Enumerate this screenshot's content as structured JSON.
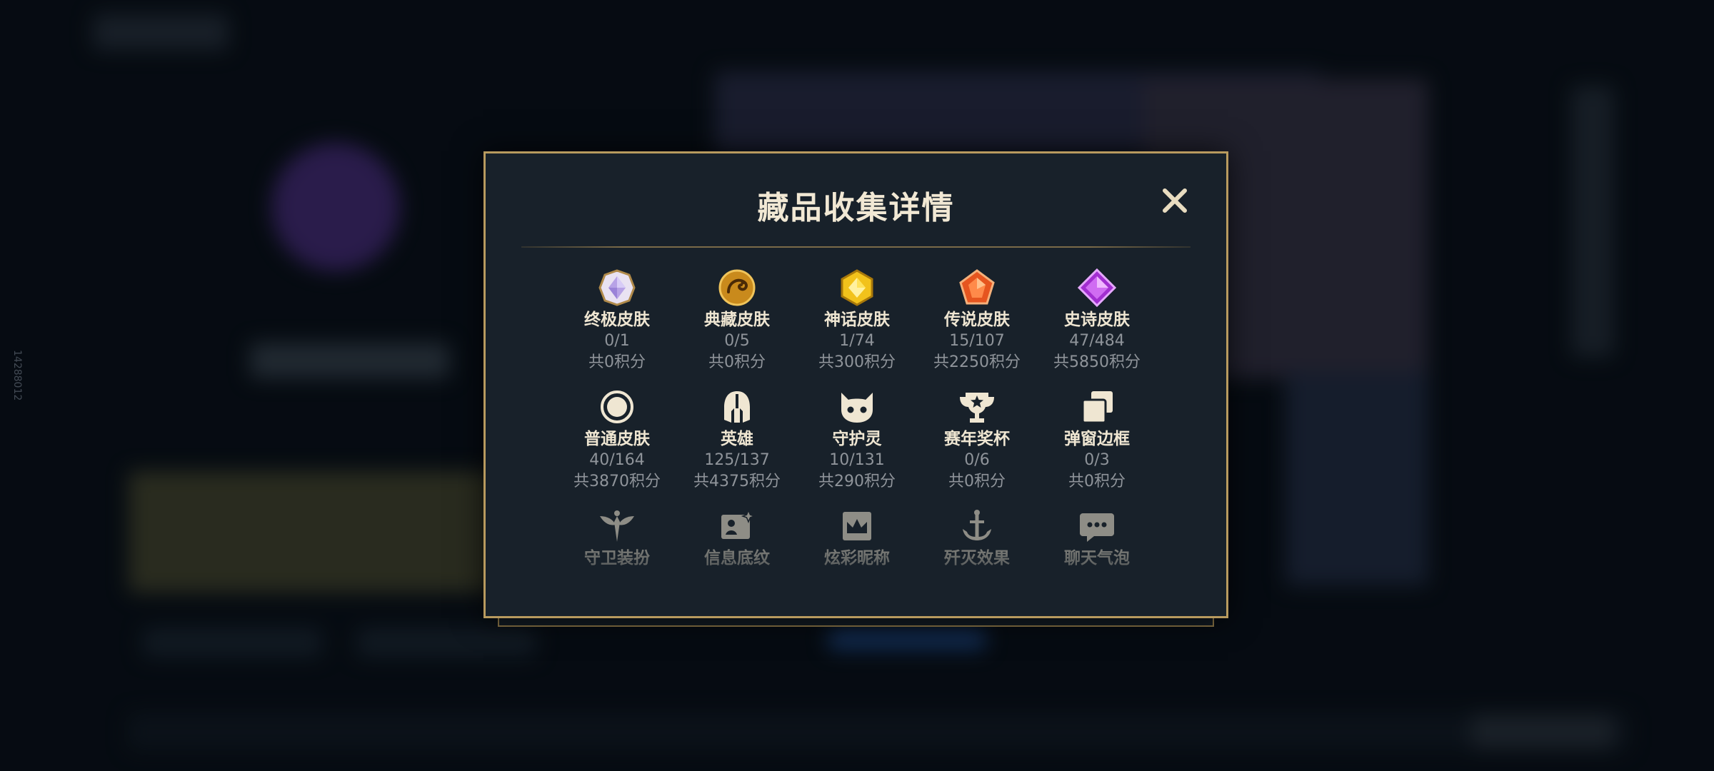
{
  "side_id": "14288012",
  "modal": {
    "title": "藏品收集详情",
    "close_icon": "close-icon"
  },
  "rows": [
    [
      {
        "label": "终极皮肤",
        "count": "0/1",
        "points": "共0积分",
        "icon": "ultimate-gem-icon",
        "color": "#c9b6f0"
      },
      {
        "label": "典藏皮肤",
        "count": "0/5",
        "points": "共0积分",
        "icon": "dragon-emblem-icon",
        "color": "#e0a93a"
      },
      {
        "label": "神话皮肤",
        "count": "1/74",
        "points": "共300积分",
        "icon": "mythic-gem-icon",
        "color": "#f2c21b"
      },
      {
        "label": "传说皮肤",
        "count": "15/107",
        "points": "共2250积分",
        "icon": "legendary-gem-icon",
        "color": "#ee6a2a"
      },
      {
        "label": "史诗皮肤",
        "count": "47/484",
        "points": "共5850积分",
        "icon": "epic-gem-icon",
        "color": "#b03ad6"
      }
    ],
    [
      {
        "label": "普通皮肤",
        "count": "40/164",
        "points": "共3870积分",
        "icon": "ring-icon",
        "color": "#efe6d2"
      },
      {
        "label": "英雄",
        "count": "125/137",
        "points": "共4375积分",
        "icon": "helmet-icon",
        "color": "#efe6d2"
      },
      {
        "label": "守护灵",
        "count": "10/131",
        "points": "共290积分",
        "icon": "guardian-face-icon",
        "color": "#efe6d2"
      },
      {
        "label": "赛年奖杯",
        "count": "0/6",
        "points": "共0积分",
        "icon": "trophy-icon",
        "color": "#efe6d2"
      },
      {
        "label": "弹窗边框",
        "count": "0/3",
        "points": "共0积分",
        "icon": "frames-icon",
        "color": "#efe6d2"
      }
    ],
    [
      {
        "label": "守卫装扮",
        "icon": "ward-wings-icon",
        "color": "#efe6d2"
      },
      {
        "label": "信息底纹",
        "icon": "card-sparkle-icon",
        "color": "#efe6d2"
      },
      {
        "label": "炫彩昵称",
        "icon": "crown-card-icon",
        "color": "#efe6d2"
      },
      {
        "label": "歼灭效果",
        "icon": "anchor-icon",
        "color": "#efe6d2"
      },
      {
        "label": "聊天气泡",
        "icon": "chat-bubble-icon",
        "color": "#efe6d2"
      }
    ]
  ]
}
